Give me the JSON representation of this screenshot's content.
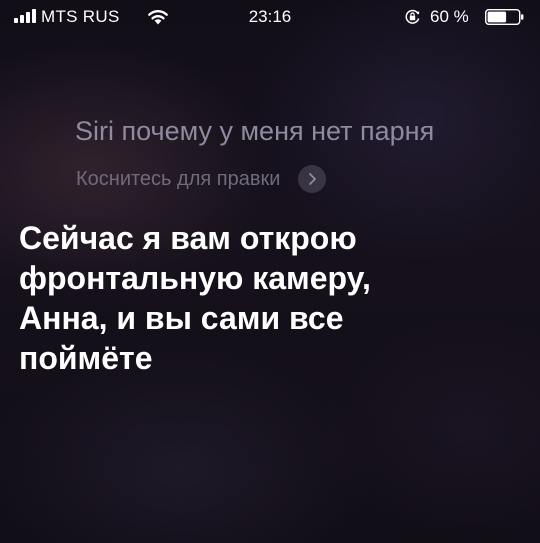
{
  "status_bar": {
    "carrier": "MTS RUS",
    "time": "23:16",
    "battery_percent": "60 %",
    "icons": [
      "signal-icon",
      "wifi-icon",
      "orientation-lock-icon",
      "battery-icon"
    ]
  },
  "siri": {
    "query": "Siri почему у меня нет парня",
    "edit_hint": "Коснитесь для правки",
    "response_lines": [
      "Сейчас я вам открою",
      "фронтальную камеру,",
      "Анна, и вы сами все",
      "поймёте"
    ]
  },
  "colors": {
    "background": "#0c0912",
    "query_text": "#8e8ba0",
    "hint_text": "#6e6b7c",
    "response_text": "#ffffff"
  }
}
